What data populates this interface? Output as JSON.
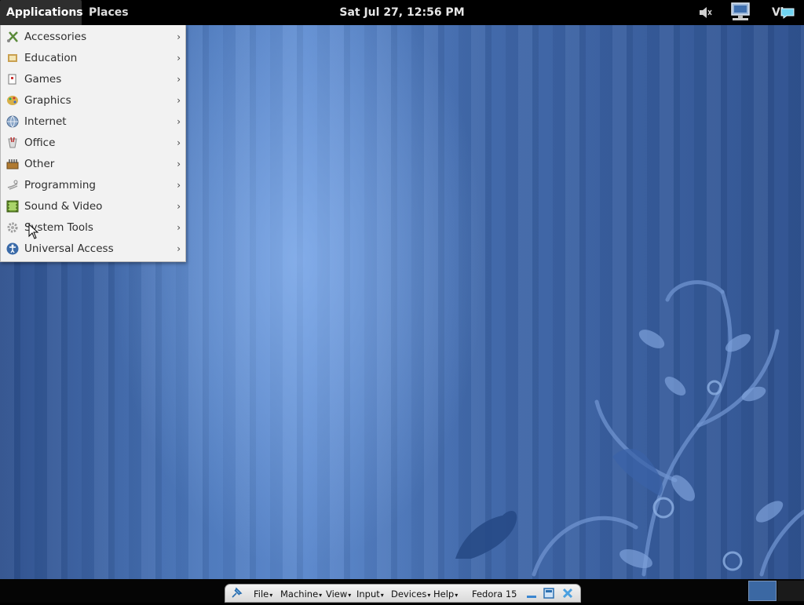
{
  "top_panel": {
    "applications_label": "Applications",
    "places_label": "Places",
    "clock": "Sat Jul 27, 12:56 PM",
    "user_label": "Vi"
  },
  "applications_menu": {
    "items": [
      {
        "label": "Accessories",
        "icon": "accessories-icon"
      },
      {
        "label": "Education",
        "icon": "education-icon"
      },
      {
        "label": "Games",
        "icon": "games-icon"
      },
      {
        "label": "Graphics",
        "icon": "graphics-icon"
      },
      {
        "label": "Internet",
        "icon": "internet-icon"
      },
      {
        "label": "Office",
        "icon": "office-icon"
      },
      {
        "label": "Other",
        "icon": "other-icon"
      },
      {
        "label": "Programming",
        "icon": "programming-icon"
      },
      {
        "label": "Sound & Video",
        "icon": "sound-video-icon"
      },
      {
        "label": "System Tools",
        "icon": "system-tools-icon"
      },
      {
        "label": "Universal Access",
        "icon": "universal-access-icon"
      }
    ],
    "submenu_arrow": "›"
  },
  "vbox_bar": {
    "menus": [
      "File",
      "Machine",
      "View",
      "Input",
      "Devices",
      "Help"
    ],
    "vm_name": "Fedora 15"
  },
  "colors": {
    "panel": "#000000",
    "menu_bg": "#f2f2f2",
    "desktop_blue": "#4b77bb"
  }
}
